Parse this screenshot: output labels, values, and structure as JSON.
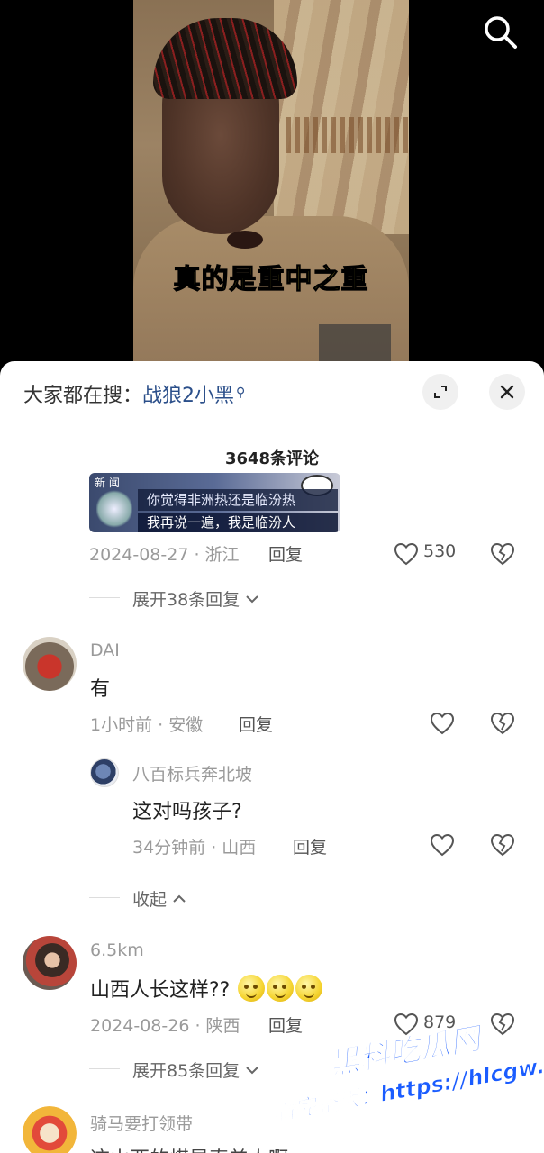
{
  "video": {
    "subtitle": "真的是重中之重"
  },
  "top_icons": {
    "search_icon": "search-icon"
  },
  "search_bar": {
    "prefix": "大家都在搜：",
    "keyword": "战狼2小黑",
    "search_glyph": "⚲"
  },
  "comments_header": {
    "count_label": "3648条评论"
  },
  "image_card": {
    "tag": "新 闻",
    "line1": "你觉得非洲热还是临汾热",
    "line2": "我再说一遍，我是临汾人"
  },
  "comment1": {
    "meta": "2024-08-27 · 浙江",
    "reply": "回复",
    "likes": "530",
    "expand": "展开38条回复"
  },
  "comment2": {
    "user": "DAI",
    "text": "有",
    "meta": "1小时前 · 安徽",
    "reply": "回复",
    "sub_reply": {
      "user": "八百标兵奔北坡",
      "text": "这对吗孩子?",
      "meta": "34分钟前 · 山西",
      "reply": "回复"
    },
    "collapse": "收起"
  },
  "comment3": {
    "user": "6.5km",
    "text": "山西人长这样??",
    "meta": "2024-08-26 · 陕西",
    "reply": "回复",
    "likes": "879",
    "expand": "展开85条回复"
  },
  "comment4": {
    "user": "骑马要打领带",
    "text": "这山西的煤是真美人啊"
  },
  "watermark": {
    "line1": "黑料吃瓜网",
    "line2": "看完整版：https://hlcgw.net"
  },
  "colors": {
    "subtitle": "#ffe83a",
    "keyword": "#2b4f8a",
    "watermark": "#1a5cff"
  }
}
